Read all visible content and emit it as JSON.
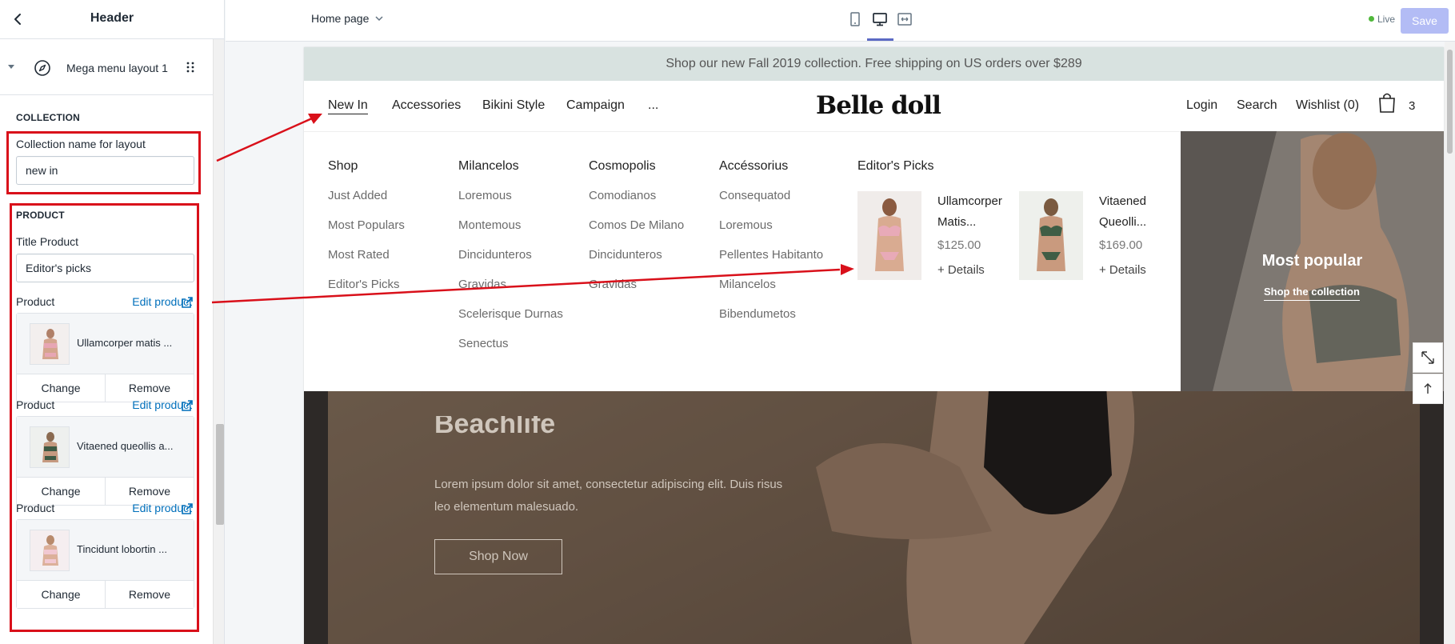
{
  "sidebar": {
    "title": "Header",
    "block": {
      "label": "Mega menu layout 1"
    },
    "collection": {
      "heading": "COLLECTION",
      "field_label": "Collection name for layout",
      "field_value": "new in"
    },
    "product": {
      "heading": "PRODUCT",
      "title_label": "Title Product",
      "title_value": "Editor's picks",
      "items": [
        {
          "label": "Product",
          "edit": "Edit product",
          "name": "Ullamcorper matis ...",
          "change": "Change",
          "remove": "Remove"
        },
        {
          "label": "Product",
          "edit": "Edit product",
          "name": "Vitaened queollis a...",
          "change": "Change",
          "remove": "Remove"
        },
        {
          "label": "Product",
          "edit": "Edit product",
          "name": "Tincidunt lobortin ...",
          "change": "Change",
          "remove": "Remove"
        }
      ]
    }
  },
  "topbar": {
    "page_select": "Home page",
    "live": "Live",
    "save": "Save"
  },
  "store": {
    "promo": "Shop our new Fall 2019 collection. Free shipping on US orders over $289",
    "nav_left": [
      "New In",
      "Accessories",
      "Bikini Style",
      "Campaign",
      "..."
    ],
    "logo": "Belle doll",
    "nav_right": {
      "login": "Login",
      "search": "Search",
      "wishlist": "Wishlist (0)",
      "cart_count": "3"
    },
    "mega": {
      "columns": [
        {
          "head": "Shop",
          "items": [
            "Just Added",
            "Most Populars",
            "Most Rated",
            "Editor's Picks"
          ]
        },
        {
          "head": "Milancelos",
          "items": [
            "Loremous",
            "Montemous",
            "Dincidunteros",
            "Gravidas",
            "Scelerisque Durnas",
            "Senectus"
          ]
        },
        {
          "head": "Cosmopolis",
          "items": [
            "Comodianos",
            "Comos De Milano",
            "Dincidunteros",
            "Gravidas"
          ]
        },
        {
          "head": "Accéssorius",
          "items": [
            "Consequatod",
            "Loremous",
            "Pellentes Habitanto",
            "Milancelos",
            "Bibendumetos"
          ]
        }
      ],
      "picks_head": "Editor's Picks",
      "picks": [
        {
          "name": "Ullamcorper Matis...",
          "price": "$125.00",
          "details": "+ Details"
        },
        {
          "name": "Vitaened Queolli...",
          "price": "$169.00",
          "details": "+ Details"
        }
      ],
      "promo_title": "Most popular",
      "promo_link": "Shop the collection"
    },
    "hero": {
      "heading": "Beachlife",
      "text": "Lorem ipsum dolor sit amet, consectetur adipiscing elit. Duis risus leo elementum malesuado.",
      "button": "Shop Now"
    }
  },
  "colors": {
    "accent": "#5c6ac4",
    "annotation_red": "#d9101a",
    "promo_bar": "#d8e2e0",
    "link": "#006fbb"
  }
}
